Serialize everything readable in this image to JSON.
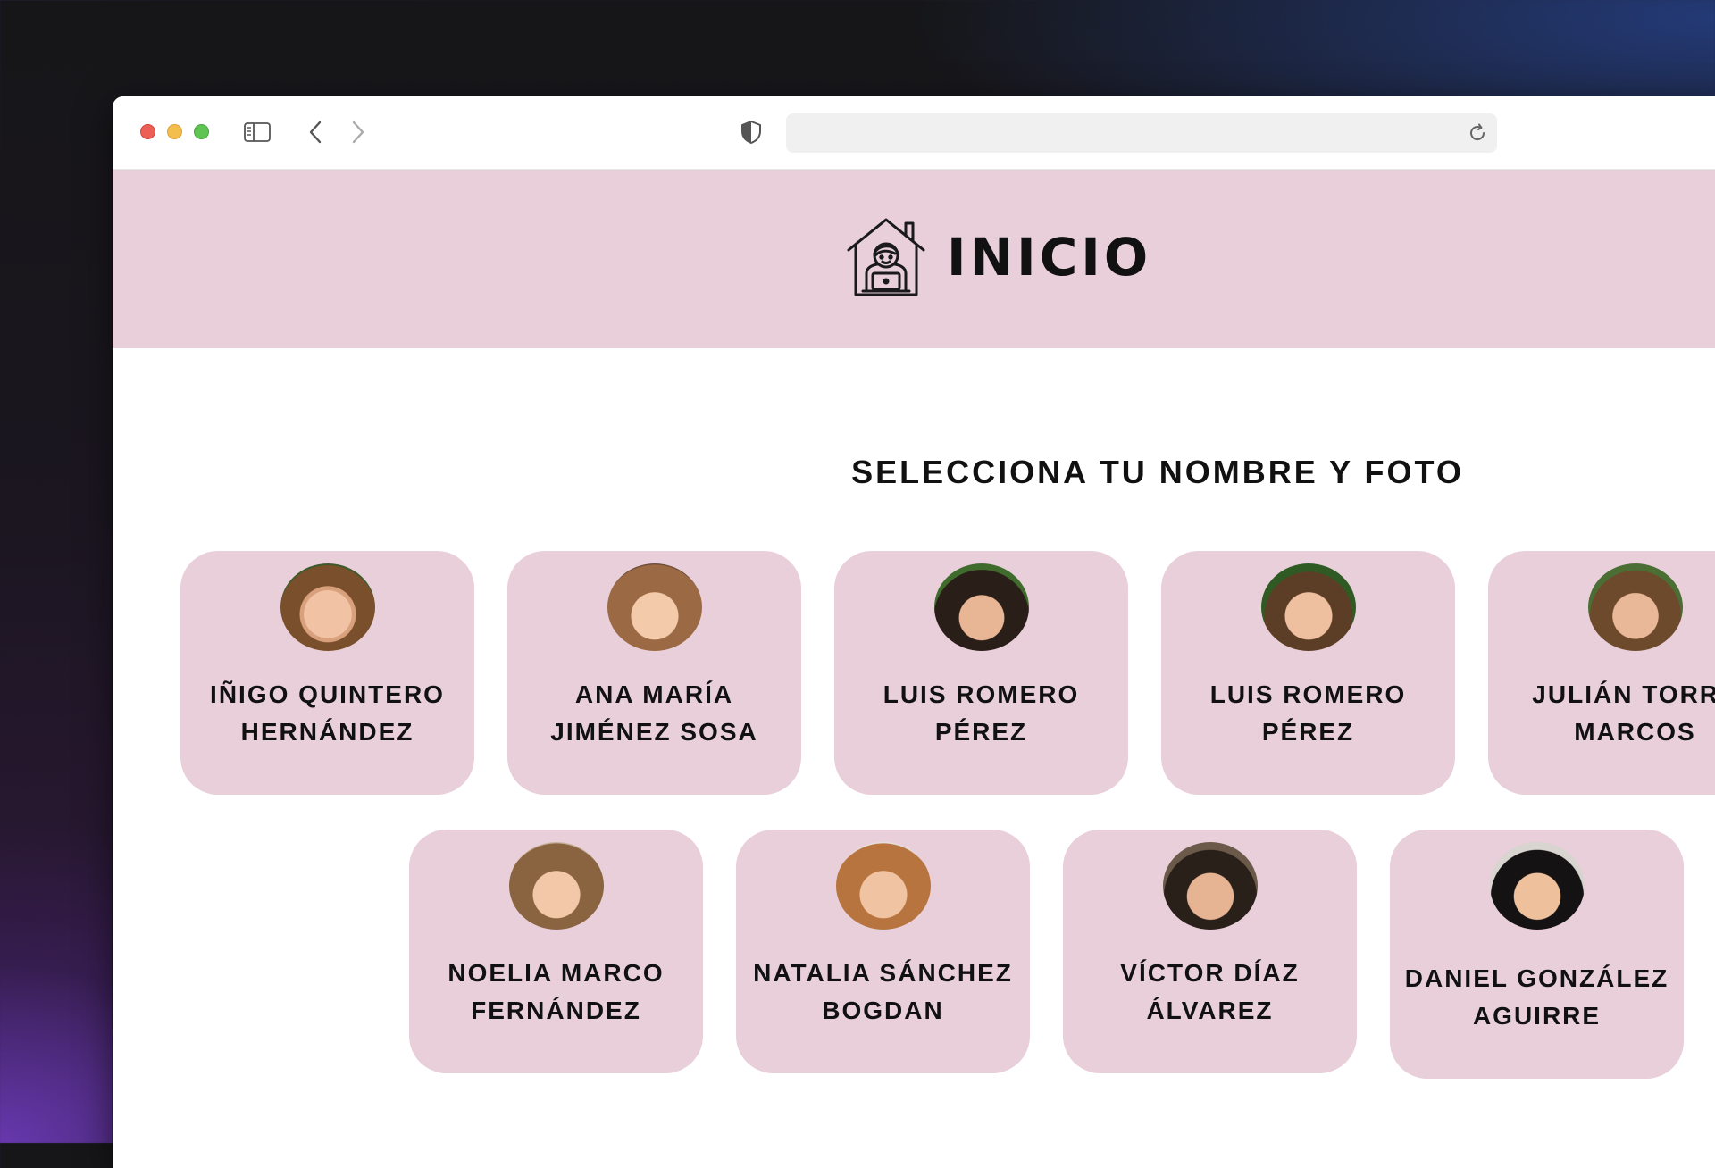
{
  "browser": {
    "url": ""
  },
  "header": {
    "title": "INICIO",
    "logo_icon": "house-student-laptop-icon",
    "background": "#e8cfda"
  },
  "main": {
    "subtitle": "SELECCIONA TU NOMBRE Y FOTO",
    "students": [
      {
        "line1": "IÑIGO QUINTERO",
        "line2": "HERNÁNDEZ",
        "photo": "boy-toddler-photo"
      },
      {
        "line1": "ANA MARÍA",
        "line2": "JIMÉNEZ SOSA",
        "photo": "girl-photo"
      },
      {
        "line1": "LUIS ROMERO",
        "line2": "PÉREZ",
        "photo": "boy-photo"
      },
      {
        "line1": "LUIS ROMERO",
        "line2": "PÉREZ",
        "photo": "boy-photo"
      },
      {
        "line1": "JULIÁN TORRE",
        "line2": "MARCOS",
        "photo": "boy-photo"
      },
      {
        "line1": "NOELIA MARCO",
        "line2": "FERNÁNDEZ",
        "photo": "girl-photo"
      },
      {
        "line1": "NATALIA SÁNCHEZ",
        "line2": "BOGDAN",
        "photo": "girl-photo"
      },
      {
        "line1": "VÍCTOR DÍAZ",
        "line2": "ÁLVAREZ",
        "photo": "boy-photo"
      },
      {
        "line1": "DANIEL GONZÁLEZ",
        "line2": "AGUIRRE",
        "photo": "boy-photo"
      }
    ]
  }
}
